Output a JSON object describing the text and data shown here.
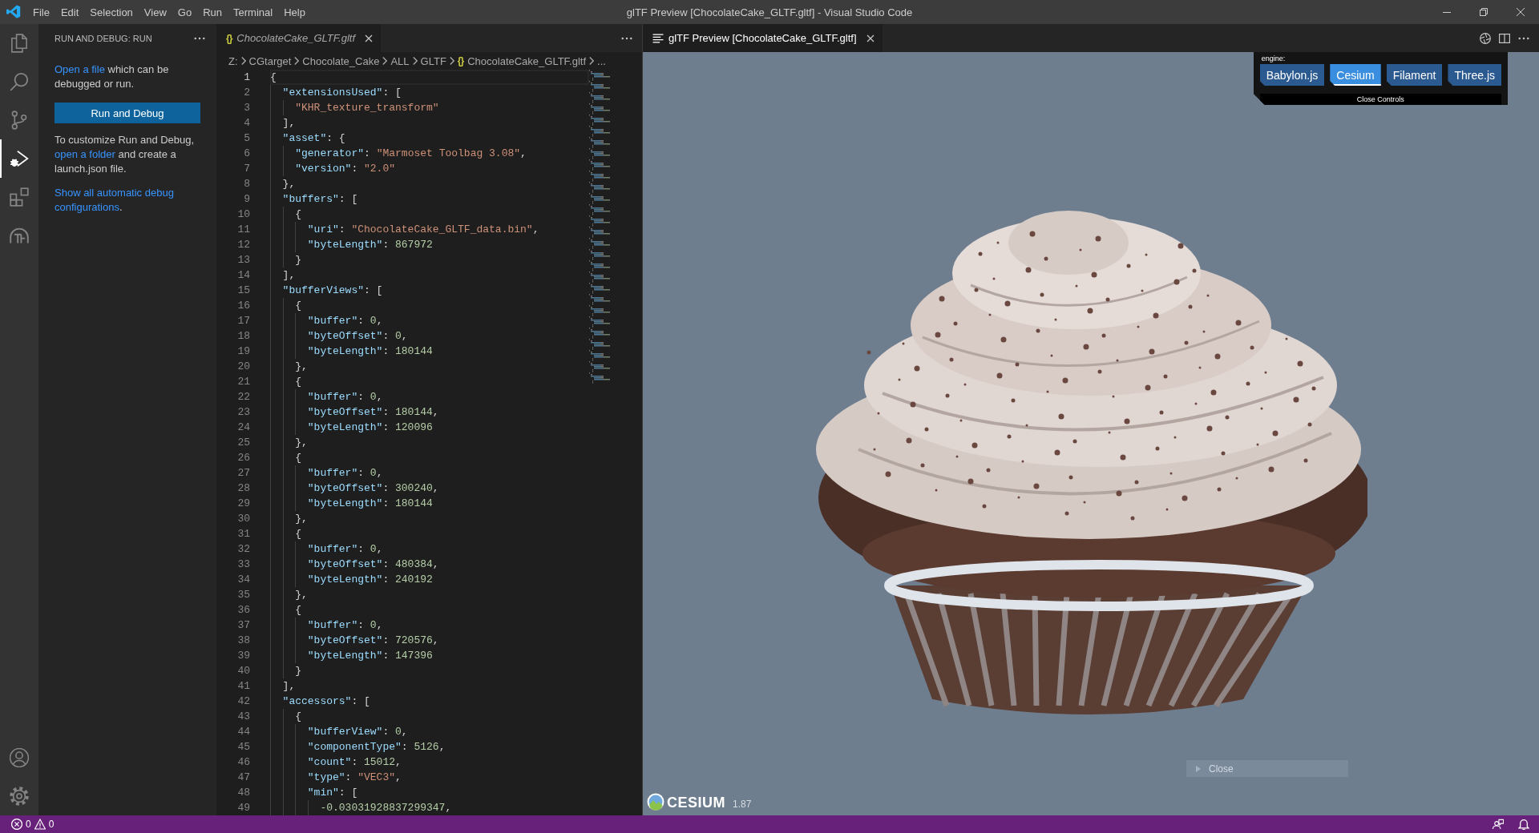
{
  "title_bar": {
    "menu": [
      "File",
      "Edit",
      "Selection",
      "View",
      "Go",
      "Run",
      "Terminal",
      "Help"
    ],
    "title": "glTF Preview [ChocolateCake_GLTF.gltf] - Visual Studio Code"
  },
  "activity_bar": {
    "items": [
      {
        "kind": "explorer",
        "selected": false
      },
      {
        "kind": "search",
        "selected": false
      },
      {
        "kind": "source-control",
        "selected": false
      },
      {
        "kind": "run-debug",
        "selected": true
      },
      {
        "kind": "extensions",
        "selected": false
      },
      {
        "kind": "dome",
        "selected": false
      }
    ],
    "bottom_items": [
      {
        "kind": "account"
      },
      {
        "kind": "settings"
      }
    ]
  },
  "sidebar": {
    "title": "RUN AND DEBUG: RUN",
    "intro": {
      "link": "Open a file",
      "text_after": " which can be debugged or run."
    },
    "button": "Run and Debug",
    "customize": {
      "text_before": "To customize Run and Debug, ",
      "link": "open a folder",
      "text_after": " and create a launch.json file."
    },
    "show_all": {
      "link": "Show all automatic debug configurations",
      "suffix": "."
    }
  },
  "editor": {
    "tab": {
      "file_icon": "{}",
      "label": "ChocolateCake_GLTF.gltf",
      "preview": true,
      "selected": true
    },
    "breadcrumbs": [
      {
        "kind": "folder",
        "label": "Z:"
      },
      {
        "kind": "folder",
        "label": "CGtarget"
      },
      {
        "kind": "folder",
        "label": "Chocolate_Cake"
      },
      {
        "kind": "folder",
        "label": "ALL"
      },
      {
        "kind": "folder",
        "label": "GLTF"
      },
      {
        "kind": "file",
        "file_icon": "{}",
        "label": "ChocolateCake_GLTF.gltf"
      },
      {
        "kind": "symbol",
        "label": "..."
      }
    ],
    "lines": [
      {
        "number": "1",
        "current": true,
        "tokens": [
          {
            "kind": "punct",
            "text": "{"
          }
        ],
        "children": [
          {
            "number": "2",
            "current": false,
            "tokens": [
              {
                "kind": "key",
                "text": "\"extensionsUsed\""
              },
              {
                "kind": "punct",
                "text": ": ["
              }
            ],
            "children": [
              {
                "number": "3",
                "current": false,
                "tokens": [
                  {
                    "kind": "string",
                    "text": "\"KHR_texture_transform\""
                  }
                ]
              }
            ]
          },
          {
            "number": "4",
            "current": false,
            "tokens": [
              {
                "kind": "punct",
                "text": "],"
              }
            ]
          },
          {
            "number": "5",
            "current": false,
            "tokens": [
              {
                "kind": "key",
                "text": "\"asset\""
              },
              {
                "kind": "punct",
                "text": ": {"
              }
            ],
            "children": [
              {
                "number": "6",
                "current": false,
                "tokens": [
                  {
                    "kind": "key",
                    "text": "\"generator\""
                  },
                  {
                    "kind": "punct",
                    "text": ": "
                  },
                  {
                    "kind": "string",
                    "text": "\"Marmoset Toolbag 3.08\""
                  },
                  {
                    "kind": "punct",
                    "text": ","
                  }
                ]
              },
              {
                "number": "7",
                "current": false,
                "tokens": [
                  {
                    "kind": "key",
                    "text": "\"version\""
                  },
                  {
                    "kind": "punct",
                    "text": ": "
                  },
                  {
                    "kind": "string",
                    "text": "\"2.0\""
                  }
                ]
              }
            ]
          },
          {
            "number": "8",
            "current": false,
            "tokens": [
              {
                "kind": "punct",
                "text": "},"
              }
            ]
          },
          {
            "number": "9",
            "current": false,
            "tokens": [
              {
                "kind": "key",
                "text": "\"buffers\""
              },
              {
                "kind": "punct",
                "text": ": ["
              }
            ],
            "children": [
              {
                "number": "10",
                "current": false,
                "tokens": [
                  {
                    "kind": "punct",
                    "text": "{"
                  }
                ],
                "children": [
                  {
                    "number": "11",
                    "current": false,
                    "tokens": [
                      {
                        "kind": "key",
                        "text": "\"uri\""
                      },
                      {
                        "kind": "punct",
                        "text": ": "
                      },
                      {
                        "kind": "string",
                        "text": "\"ChocolateCake_GLTF_data.bin\""
                      },
                      {
                        "kind": "punct",
                        "text": ","
                      }
                    ]
                  },
                  {
                    "number": "12",
                    "current": false,
                    "tokens": [
                      {
                        "kind": "key",
                        "text": "\"byteLength\""
                      },
                      {
                        "kind": "punct",
                        "text": ": "
                      },
                      {
                        "kind": "number",
                        "text": "867972"
                      }
                    ]
                  }
                ]
              },
              {
                "number": "13",
                "current": false,
                "tokens": [
                  {
                    "kind": "punct",
                    "text": "}"
                  }
                ]
              }
            ]
          },
          {
            "number": "14",
            "current": false,
            "tokens": [
              {
                "kind": "punct",
                "text": "],"
              }
            ]
          },
          {
            "number": "15",
            "current": false,
            "tokens": [
              {
                "kind": "key",
                "text": "\"bufferViews\""
              },
              {
                "kind": "punct",
                "text": ": ["
              }
            ],
            "children": [
              {
                "number": "16",
                "current": false,
                "tokens": [
                  {
                    "kind": "punct",
                    "text": "{"
                  }
                ],
                "children": [
                  {
                    "number": "17",
                    "current": false,
                    "tokens": [
                      {
                        "kind": "key",
                        "text": "\"buffer\""
                      },
                      {
                        "kind": "punct",
                        "text": ": "
                      },
                      {
                        "kind": "number",
                        "text": "0"
                      },
                      {
                        "kind": "punct",
                        "text": ","
                      }
                    ]
                  },
                  {
                    "number": "18",
                    "current": false,
                    "tokens": [
                      {
                        "kind": "key",
                        "text": "\"byteOffset\""
                      },
                      {
                        "kind": "punct",
                        "text": ": "
                      },
                      {
                        "kind": "number",
                        "text": "0"
                      },
                      {
                        "kind": "punct",
                        "text": ","
                      }
                    ]
                  },
                  {
                    "number": "19",
                    "current": false,
                    "tokens": [
                      {
                        "kind": "key",
                        "text": "\"byteLength\""
                      },
                      {
                        "kind": "punct",
                        "text": ": "
                      },
                      {
                        "kind": "number",
                        "text": "180144"
                      }
                    ]
                  }
                ]
              },
              {
                "number": "20",
                "current": false,
                "tokens": [
                  {
                    "kind": "punct",
                    "text": "},"
                  }
                ]
              },
              {
                "number": "21",
                "current": false,
                "tokens": [
                  {
                    "kind": "punct",
                    "text": "{"
                  }
                ],
                "children": [
                  {
                    "number": "22",
                    "current": false,
                    "tokens": [
                      {
                        "kind": "key",
                        "text": "\"buffer\""
                      },
                      {
                        "kind": "punct",
                        "text": ": "
                      },
                      {
                        "kind": "number",
                        "text": "0"
                      },
                      {
                        "kind": "punct",
                        "text": ","
                      }
                    ]
                  },
                  {
                    "number": "23",
                    "current": false,
                    "tokens": [
                      {
                        "kind": "key",
                        "text": "\"byteOffset\""
                      },
                      {
                        "kind": "punct",
                        "text": ": "
                      },
                      {
                        "kind": "number",
                        "text": "180144"
                      },
                      {
                        "kind": "punct",
                        "text": ","
                      }
                    ]
                  },
                  {
                    "number": "24",
                    "current": false,
                    "tokens": [
                      {
                        "kind": "key",
                        "text": "\"byteLength\""
                      },
                      {
                        "kind": "punct",
                        "text": ": "
                      },
                      {
                        "kind": "number",
                        "text": "120096"
                      }
                    ]
                  }
                ]
              },
              {
                "number": "25",
                "current": false,
                "tokens": [
                  {
                    "kind": "punct",
                    "text": "},"
                  }
                ]
              },
              {
                "number": "26",
                "current": false,
                "tokens": [
                  {
                    "kind": "punct",
                    "text": "{"
                  }
                ],
                "children": [
                  {
                    "number": "27",
                    "current": false,
                    "tokens": [
                      {
                        "kind": "key",
                        "text": "\"buffer\""
                      },
                      {
                        "kind": "punct",
                        "text": ": "
                      },
                      {
                        "kind": "number",
                        "text": "0"
                      },
                      {
                        "kind": "punct",
                        "text": ","
                      }
                    ]
                  },
                  {
                    "number": "28",
                    "current": false,
                    "tokens": [
                      {
                        "kind": "key",
                        "text": "\"byteOffset\""
                      },
                      {
                        "kind": "punct",
                        "text": ": "
                      },
                      {
                        "kind": "number",
                        "text": "300240"
                      },
                      {
                        "kind": "punct",
                        "text": ","
                      }
                    ]
                  },
                  {
                    "number": "29",
                    "current": false,
                    "tokens": [
                      {
                        "kind": "key",
                        "text": "\"byteLength\""
                      },
                      {
                        "kind": "punct",
                        "text": ": "
                      },
                      {
                        "kind": "number",
                        "text": "180144"
                      }
                    ]
                  }
                ]
              },
              {
                "number": "30",
                "current": false,
                "tokens": [
                  {
                    "kind": "punct",
                    "text": "},"
                  }
                ]
              },
              {
                "number": "31",
                "current": false,
                "tokens": [
                  {
                    "kind": "punct",
                    "text": "{"
                  }
                ],
                "children": [
                  {
                    "number": "32",
                    "current": false,
                    "tokens": [
                      {
                        "kind": "key",
                        "text": "\"buffer\""
                      },
                      {
                        "kind": "punct",
                        "text": ": "
                      },
                      {
                        "kind": "number",
                        "text": "0"
                      },
                      {
                        "kind": "punct",
                        "text": ","
                      }
                    ]
                  },
                  {
                    "number": "33",
                    "current": false,
                    "tokens": [
                      {
                        "kind": "key",
                        "text": "\"byteOffset\""
                      },
                      {
                        "kind": "punct",
                        "text": ": "
                      },
                      {
                        "kind": "number",
                        "text": "480384"
                      },
                      {
                        "kind": "punct",
                        "text": ","
                      }
                    ]
                  },
                  {
                    "number": "34",
                    "current": false,
                    "tokens": [
                      {
                        "kind": "key",
                        "text": "\"byteLength\""
                      },
                      {
                        "kind": "punct",
                        "text": ": "
                      },
                      {
                        "kind": "number",
                        "text": "240192"
                      }
                    ]
                  }
                ]
              },
              {
                "number": "35",
                "current": false,
                "tokens": [
                  {
                    "kind": "punct",
                    "text": "},"
                  }
                ]
              },
              {
                "number": "36",
                "current": false,
                "tokens": [
                  {
                    "kind": "punct",
                    "text": "{"
                  }
                ],
                "children": [
                  {
                    "number": "37",
                    "current": false,
                    "tokens": [
                      {
                        "kind": "key",
                        "text": "\"buffer\""
                      },
                      {
                        "kind": "punct",
                        "text": ": "
                      },
                      {
                        "kind": "number",
                        "text": "0"
                      },
                      {
                        "kind": "punct",
                        "text": ","
                      }
                    ]
                  },
                  {
                    "number": "38",
                    "current": false,
                    "tokens": [
                      {
                        "kind": "key",
                        "text": "\"byteOffset\""
                      },
                      {
                        "kind": "punct",
                        "text": ": "
                      },
                      {
                        "kind": "number",
                        "text": "720576"
                      },
                      {
                        "kind": "punct",
                        "text": ","
                      }
                    ]
                  },
                  {
                    "number": "39",
                    "current": false,
                    "tokens": [
                      {
                        "kind": "key",
                        "text": "\"byteLength\""
                      },
                      {
                        "kind": "punct",
                        "text": ": "
                      },
                      {
                        "kind": "number",
                        "text": "147396"
                      }
                    ]
                  }
                ]
              },
              {
                "number": "40",
                "current": false,
                "tokens": [
                  {
                    "kind": "punct",
                    "text": "}"
                  }
                ]
              }
            ]
          },
          {
            "number": "41",
            "current": false,
            "tokens": [
              {
                "kind": "punct",
                "text": "],"
              }
            ]
          },
          {
            "number": "42",
            "current": false,
            "tokens": [
              {
                "kind": "key",
                "text": "\"accessors\""
              },
              {
                "kind": "punct",
                "text": ": ["
              }
            ],
            "children": [
              {
                "number": "43",
                "current": false,
                "tokens": [
                  {
                    "kind": "punct",
                    "text": "{"
                  }
                ],
                "children": [
                  {
                    "number": "44",
                    "current": false,
                    "tokens": [
                      {
                        "kind": "key",
                        "text": "\"bufferView\""
                      },
                      {
                        "kind": "punct",
                        "text": ": "
                      },
                      {
                        "kind": "number",
                        "text": "0"
                      },
                      {
                        "kind": "punct",
                        "text": ","
                      }
                    ]
                  },
                  {
                    "number": "45",
                    "current": false,
                    "tokens": [
                      {
                        "kind": "key",
                        "text": "\"componentType\""
                      },
                      {
                        "kind": "punct",
                        "text": ": "
                      },
                      {
                        "kind": "number",
                        "text": "5126"
                      },
                      {
                        "kind": "punct",
                        "text": ","
                      }
                    ]
                  },
                  {
                    "number": "46",
                    "current": false,
                    "tokens": [
                      {
                        "kind": "key",
                        "text": "\"count\""
                      },
                      {
                        "kind": "punct",
                        "text": ": "
                      },
                      {
                        "kind": "number",
                        "text": "15012"
                      },
                      {
                        "kind": "punct",
                        "text": ","
                      }
                    ]
                  },
                  {
                    "number": "47",
                    "current": false,
                    "tokens": [
                      {
                        "kind": "key",
                        "text": "\"type\""
                      },
                      {
                        "kind": "punct",
                        "text": ": "
                      },
                      {
                        "kind": "string",
                        "text": "\"VEC3\""
                      },
                      {
                        "kind": "punct",
                        "text": ","
                      }
                    ]
                  },
                  {
                    "number": "48",
                    "current": false,
                    "tokens": [
                      {
                        "kind": "key",
                        "text": "\"min\""
                      },
                      {
                        "kind": "punct",
                        "text": ": ["
                      }
                    ],
                    "children": [
                      {
                        "number": "49",
                        "current": false,
                        "tokens": [
                          {
                            "kind": "number",
                            "text": "-0.03031928837299347"
                          },
                          {
                            "kind": "punct",
                            "text": ","
                          }
                        ]
                      }
                    ]
                  }
                ]
              }
            ]
          }
        ]
      }
    ]
  },
  "preview": {
    "tab": {
      "label": "glTF Preview [ChocolateCake_GLTF.gltf]",
      "selected": true
    },
    "controls": {
      "caption": "engine:",
      "engines": [
        {
          "label": "Babylon.js",
          "selected": false
        },
        {
          "label": "Cesium",
          "selected": true
        },
        {
          "label": "Filament",
          "selected": false
        },
        {
          "label": "Three.js",
          "selected": false
        }
      ],
      "close_label": "Close Controls"
    },
    "viewer": {
      "logo_text": "CESIUM",
      "version": "1.87"
    },
    "overlay_button": {
      "label": "Close"
    }
  },
  "status_bar": {
    "errors": "0",
    "warnings": "0"
  }
}
